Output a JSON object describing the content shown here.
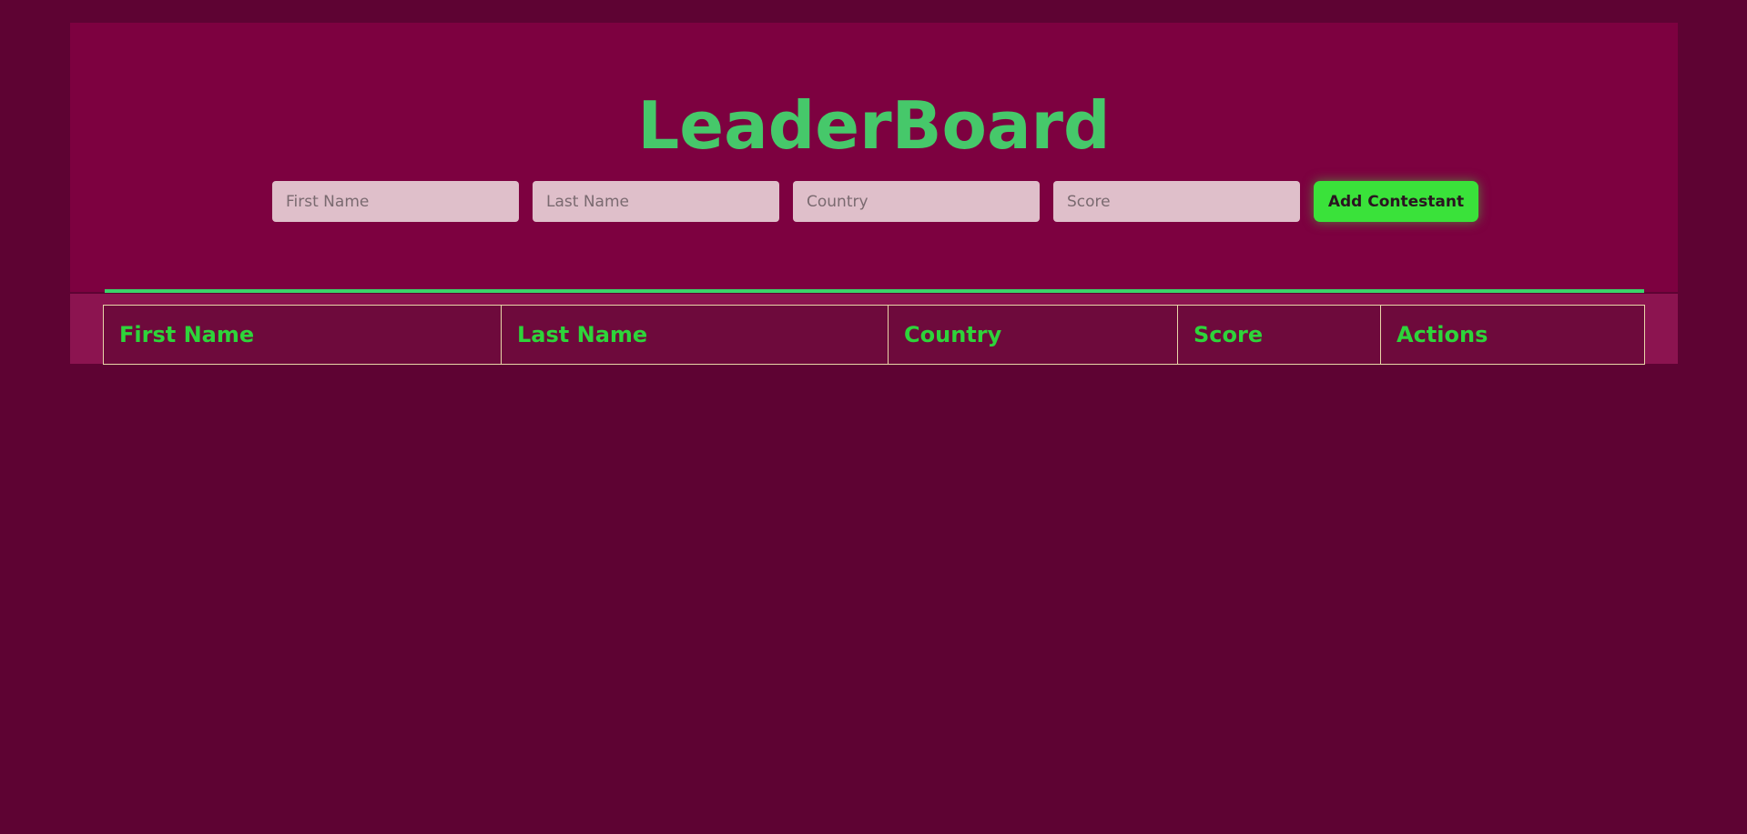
{
  "header": {
    "title": "LeaderBoard"
  },
  "form": {
    "first_name_placeholder": "First Name",
    "last_name_placeholder": "Last Name",
    "country_placeholder": "Country",
    "score_placeholder": "Score",
    "submit_label": "Add Contestant"
  },
  "table": {
    "columns": [
      "First Name",
      "Last Name",
      "Country",
      "Score",
      "Actions"
    ]
  },
  "colors": {
    "page_background": "#5e0333",
    "header_background": "#7d0140",
    "accent_green": "#46c86a",
    "button_green": "#3ae23a",
    "table_header_text": "#2ed43a"
  }
}
